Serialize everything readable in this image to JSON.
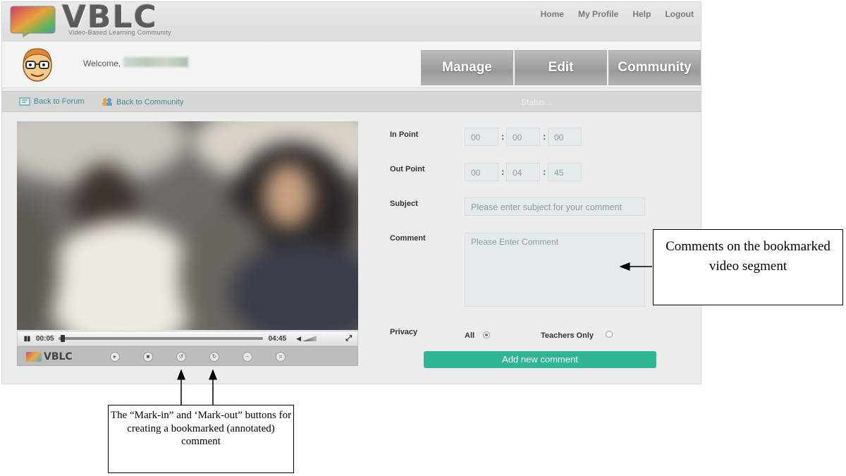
{
  "header": {
    "logo_text": "VBLC",
    "logo_tagline": "Video-Based Learning Community",
    "nav": [
      "Home",
      "My Profile",
      "Help",
      "Logout"
    ]
  },
  "user": {
    "welcome_label": "Welcome,"
  },
  "main_tabs": [
    "Manage",
    "Edit",
    "Community"
  ],
  "subnav": {
    "back_forum": "Back to Forum",
    "back_community": "Back to Community",
    "status": "Status..."
  },
  "player": {
    "current_time": "00:05",
    "duration": "04:45",
    "progress_fraction": 0.018,
    "brand": "VBLC"
  },
  "form": {
    "in_point_label": "In Point",
    "in_point": [
      "00",
      "00",
      "00"
    ],
    "out_point_label": "Out Point",
    "out_point": [
      "00",
      "04",
      "45"
    ],
    "subject_label": "Subject",
    "subject_placeholder": "Please enter subject for your comment",
    "comment_label": "Comment",
    "comment_placeholder": "Please Enter Comment",
    "privacy_label": "Privacy",
    "privacy_options": [
      "All",
      "Teachers Only"
    ],
    "privacy_selected": "All",
    "submit_label": "Add new comment"
  },
  "annotations": {
    "comments_note": "Comments on the bookmarked video segment",
    "markin_note": "The “Mark-in” and ‘Mark-out” buttons for creating a bookmarked (annotated) comment"
  },
  "colors": {
    "accent": "#2fb594",
    "link": "#3b8a95",
    "tab_gray": "#a8a8a8"
  }
}
